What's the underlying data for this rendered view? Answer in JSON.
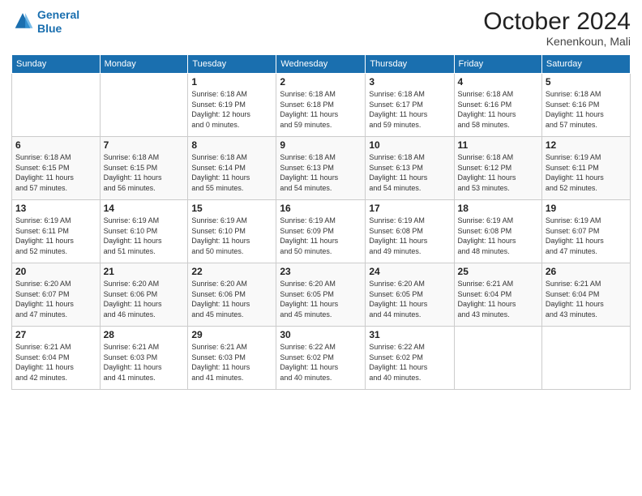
{
  "header": {
    "logo_line1": "General",
    "logo_line2": "Blue",
    "month": "October 2024",
    "location": "Kenenkoun, Mali"
  },
  "weekdays": [
    "Sunday",
    "Monday",
    "Tuesday",
    "Wednesday",
    "Thursday",
    "Friday",
    "Saturday"
  ],
  "weeks": [
    [
      {
        "day": "",
        "info": ""
      },
      {
        "day": "",
        "info": ""
      },
      {
        "day": "1",
        "info": "Sunrise: 6:18 AM\nSunset: 6:19 PM\nDaylight: 12 hours\nand 0 minutes."
      },
      {
        "day": "2",
        "info": "Sunrise: 6:18 AM\nSunset: 6:18 PM\nDaylight: 11 hours\nand 59 minutes."
      },
      {
        "day": "3",
        "info": "Sunrise: 6:18 AM\nSunset: 6:17 PM\nDaylight: 11 hours\nand 59 minutes."
      },
      {
        "day": "4",
        "info": "Sunrise: 6:18 AM\nSunset: 6:16 PM\nDaylight: 11 hours\nand 58 minutes."
      },
      {
        "day": "5",
        "info": "Sunrise: 6:18 AM\nSunset: 6:16 PM\nDaylight: 11 hours\nand 57 minutes."
      }
    ],
    [
      {
        "day": "6",
        "info": "Sunrise: 6:18 AM\nSunset: 6:15 PM\nDaylight: 11 hours\nand 57 minutes."
      },
      {
        "day": "7",
        "info": "Sunrise: 6:18 AM\nSunset: 6:15 PM\nDaylight: 11 hours\nand 56 minutes."
      },
      {
        "day": "8",
        "info": "Sunrise: 6:18 AM\nSunset: 6:14 PM\nDaylight: 11 hours\nand 55 minutes."
      },
      {
        "day": "9",
        "info": "Sunrise: 6:18 AM\nSunset: 6:13 PM\nDaylight: 11 hours\nand 54 minutes."
      },
      {
        "day": "10",
        "info": "Sunrise: 6:18 AM\nSunset: 6:13 PM\nDaylight: 11 hours\nand 54 minutes."
      },
      {
        "day": "11",
        "info": "Sunrise: 6:18 AM\nSunset: 6:12 PM\nDaylight: 11 hours\nand 53 minutes."
      },
      {
        "day": "12",
        "info": "Sunrise: 6:19 AM\nSunset: 6:11 PM\nDaylight: 11 hours\nand 52 minutes."
      }
    ],
    [
      {
        "day": "13",
        "info": "Sunrise: 6:19 AM\nSunset: 6:11 PM\nDaylight: 11 hours\nand 52 minutes."
      },
      {
        "day": "14",
        "info": "Sunrise: 6:19 AM\nSunset: 6:10 PM\nDaylight: 11 hours\nand 51 minutes."
      },
      {
        "day": "15",
        "info": "Sunrise: 6:19 AM\nSunset: 6:10 PM\nDaylight: 11 hours\nand 50 minutes."
      },
      {
        "day": "16",
        "info": "Sunrise: 6:19 AM\nSunset: 6:09 PM\nDaylight: 11 hours\nand 50 minutes."
      },
      {
        "day": "17",
        "info": "Sunrise: 6:19 AM\nSunset: 6:08 PM\nDaylight: 11 hours\nand 49 minutes."
      },
      {
        "day": "18",
        "info": "Sunrise: 6:19 AM\nSunset: 6:08 PM\nDaylight: 11 hours\nand 48 minutes."
      },
      {
        "day": "19",
        "info": "Sunrise: 6:19 AM\nSunset: 6:07 PM\nDaylight: 11 hours\nand 47 minutes."
      }
    ],
    [
      {
        "day": "20",
        "info": "Sunrise: 6:20 AM\nSunset: 6:07 PM\nDaylight: 11 hours\nand 47 minutes."
      },
      {
        "day": "21",
        "info": "Sunrise: 6:20 AM\nSunset: 6:06 PM\nDaylight: 11 hours\nand 46 minutes."
      },
      {
        "day": "22",
        "info": "Sunrise: 6:20 AM\nSunset: 6:06 PM\nDaylight: 11 hours\nand 45 minutes."
      },
      {
        "day": "23",
        "info": "Sunrise: 6:20 AM\nSunset: 6:05 PM\nDaylight: 11 hours\nand 45 minutes."
      },
      {
        "day": "24",
        "info": "Sunrise: 6:20 AM\nSunset: 6:05 PM\nDaylight: 11 hours\nand 44 minutes."
      },
      {
        "day": "25",
        "info": "Sunrise: 6:21 AM\nSunset: 6:04 PM\nDaylight: 11 hours\nand 43 minutes."
      },
      {
        "day": "26",
        "info": "Sunrise: 6:21 AM\nSunset: 6:04 PM\nDaylight: 11 hours\nand 43 minutes."
      }
    ],
    [
      {
        "day": "27",
        "info": "Sunrise: 6:21 AM\nSunset: 6:04 PM\nDaylight: 11 hours\nand 42 minutes."
      },
      {
        "day": "28",
        "info": "Sunrise: 6:21 AM\nSunset: 6:03 PM\nDaylight: 11 hours\nand 41 minutes."
      },
      {
        "day": "29",
        "info": "Sunrise: 6:21 AM\nSunset: 6:03 PM\nDaylight: 11 hours\nand 41 minutes."
      },
      {
        "day": "30",
        "info": "Sunrise: 6:22 AM\nSunset: 6:02 PM\nDaylight: 11 hours\nand 40 minutes."
      },
      {
        "day": "31",
        "info": "Sunrise: 6:22 AM\nSunset: 6:02 PM\nDaylight: 11 hours\nand 40 minutes."
      },
      {
        "day": "",
        "info": ""
      },
      {
        "day": "",
        "info": ""
      }
    ]
  ]
}
